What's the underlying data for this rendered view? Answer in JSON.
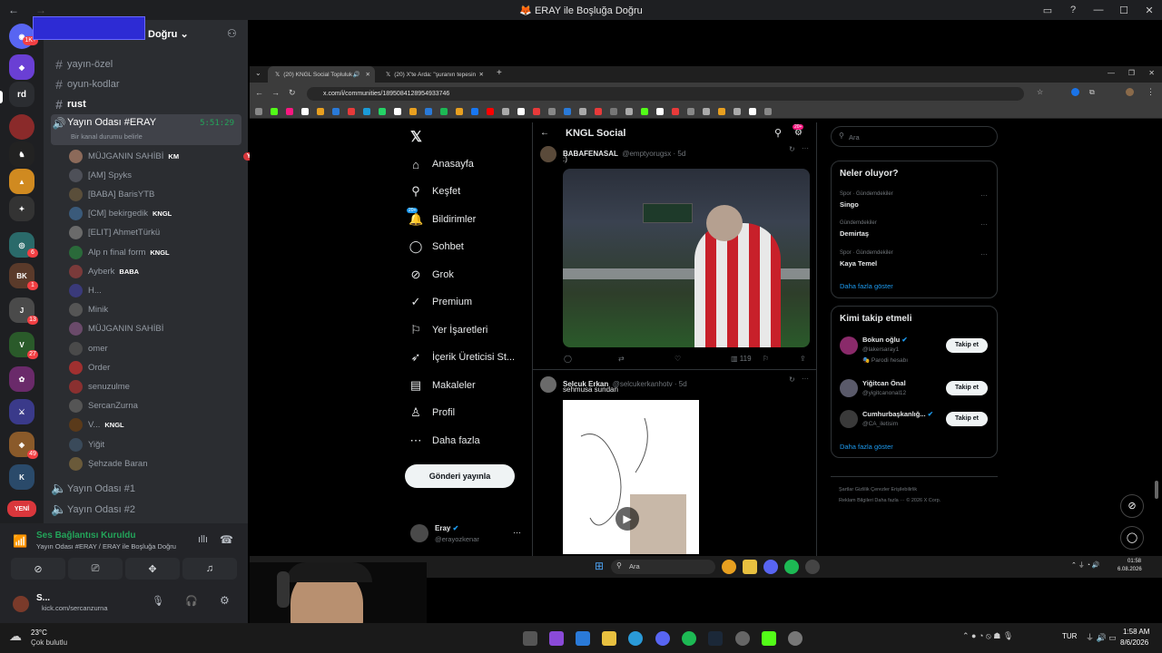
{
  "window": {
    "title": "🦊 ERAY ile Boşluğa Doğru"
  },
  "discord": {
    "server_label": "ERAY ile Boşluğa Doğru",
    "rail_badges": {
      "top": "1K+",
      "rd": "rd",
      "b1": "1",
      "b2": "6",
      "b3": "1",
      "b4": "13",
      "b5": "27",
      "b6": "49",
      "b7": "0"
    },
    "new_badge": "YENİ",
    "channels": [
      {
        "name": "yayın-özel"
      },
      {
        "name": "oyun-kodlar"
      },
      {
        "name": "rust"
      }
    ],
    "voice_room": {
      "name": "Yayın Odası #ERAY",
      "time": "5:51:29",
      "status_hint": "Bir kanal durumu belirle"
    },
    "members": [
      {
        "name": "MÜJGANIN SAHİBİ",
        "tag": "KM",
        "live": "YAYINDA",
        "color": "#8c6a5a"
      },
      {
        "name": "[AM] Spyks",
        "tag": "",
        "color": "#4e5058"
      },
      {
        "name": "[BABA] BarisYTB",
        "tag": "",
        "color": "#5a4e3a"
      },
      {
        "name": "[CM] bekirgedik",
        "tag": "KNGL",
        "color": "#3a5a7a"
      },
      {
        "name": "[ELIT] AhmetTürkü",
        "tag": "",
        "color": "#6a6a6a"
      },
      {
        "name": "Alp n final form",
        "tag": "KNGL",
        "color": "#2a6a3a"
      },
      {
        "name": "Ayberk",
        "tag": "BABA",
        "color": "#7a3a3a"
      },
      {
        "name": "H...",
        "tag": "",
        "color": "#3a3a7a"
      },
      {
        "name": "Minik",
        "tag": "",
        "color": "#555"
      },
      {
        "name": "MÜJGANIN SAHİBİ",
        "tag": "",
        "color": "#6a4a6a"
      },
      {
        "name": "omer",
        "tag": "",
        "color": "#4a4a4a"
      },
      {
        "name": "Order",
        "tag": "",
        "color": "#a03030"
      },
      {
        "name": "senuzulme",
        "tag": "",
        "color": "#8a3030"
      },
      {
        "name": "SercanZurna",
        "tag": "",
        "color": "#555"
      },
      {
        "name": "V...",
        "tag": "KNGL",
        "color": "#5a3a1a"
      },
      {
        "name": "Yiğit",
        "tag": "",
        "color": "#3a4a5a"
      },
      {
        "name": "Şehzade Baran",
        "tag": "",
        "color": "#6a5a3a"
      }
    ],
    "voice_rooms_below": [
      "Yayın Odası #1",
      "Yayın Odası #2"
    ],
    "voice_panel": {
      "title": "Ses Bağlantısı Kuruldu",
      "subtitle": "Yayın Odası #ERAY / ERAY ile Boşluğa Doğru"
    },
    "user_panel": {
      "name": "S...",
      "status": "kick.com/sercanzurna"
    }
  },
  "browser": {
    "tabs": [
      {
        "label": "(20) KNGL Social Topluluk /"
      },
      {
        "label": "(20) X'te Arda: \"şuranın tepesin"
      }
    ],
    "new_tab": "+",
    "url": "x.com/i/communities/1895084128954933746"
  },
  "x": {
    "nav": [
      {
        "label": "Anasayfa",
        "icon": "⌂"
      },
      {
        "label": "Keşfet",
        "icon": "⚲"
      },
      {
        "label": "Bildirimler",
        "icon": "🔔",
        "badge": "20+"
      },
      {
        "label": "Sohbet",
        "icon": "◯"
      },
      {
        "label": "Grok",
        "icon": "⊘"
      },
      {
        "label": "Premium",
        "icon": "✓"
      },
      {
        "label": "Yer İşaretleri",
        "icon": "⚐"
      },
      {
        "label": "İçerik Üreticisi St...",
        "icon": "➶"
      },
      {
        "label": "Makaleler",
        "icon": "▤"
      },
      {
        "label": "Profil",
        "icon": "♙"
      },
      {
        "label": "Daha fazla",
        "icon": "⋯"
      }
    ],
    "post_button": "Gönderi yayınla",
    "account": {
      "name": "Eray",
      "handle": "@erayozkenar"
    },
    "header": {
      "title": "KNGL Social",
      "badge": "20+"
    },
    "posts": [
      {
        "name": "BABAFENASAL",
        "handle": "@emptyorugsx · 5d",
        "text": ":)",
        "views": "119"
      },
      {
        "name": "Selcuk Erkan",
        "handle": "@selcukerkanhotv · 5d",
        "text": "sehmusa sundan"
      }
    ],
    "search_placeholder": "Ara",
    "trends": {
      "title": "Neler oluyor?",
      "items": [
        {
          "category": "Spor · Gündemdekiler",
          "name": "Singo"
        },
        {
          "category": "Gündemdekiler",
          "name": "Demirtaş"
        },
        {
          "category": "Spor · Gündemdekiler",
          "name": "Kaya Temel"
        }
      ],
      "more": "Daha fazla göster"
    },
    "who_to_follow": {
      "title": "Kimi takip etmeli",
      "items": [
        {
          "name": "Bokun oğlu",
          "handle": "@lakersaray1",
          "note": "Parodi hesabı",
          "button": "Takip et"
        },
        {
          "name": "Yiğitcan Önal",
          "handle": "@yigitcanonal12",
          "button": "Takip et"
        },
        {
          "name": "Cumhurbaşkanlığ...",
          "handle": "@CA_iletisim",
          "button": "Takip et"
        }
      ],
      "more": "Daha fazla göster"
    },
    "footer": {
      "line1": "Şartlar  Gizlilik  Çerezler  Erişilebilirlik",
      "line2": "Reklam Bilgileri  Daha fazla ···  © 2026 X Corp."
    }
  },
  "inner_taskbar": {
    "search": "Ara",
    "time": "01:58",
    "date": "6.08.2026"
  },
  "taskbar": {
    "weather_temp": "23°C",
    "weather_desc": "Çok bulutlu",
    "lang": "TUR",
    "time": "1:58 AM",
    "date": "8/6/2026"
  }
}
